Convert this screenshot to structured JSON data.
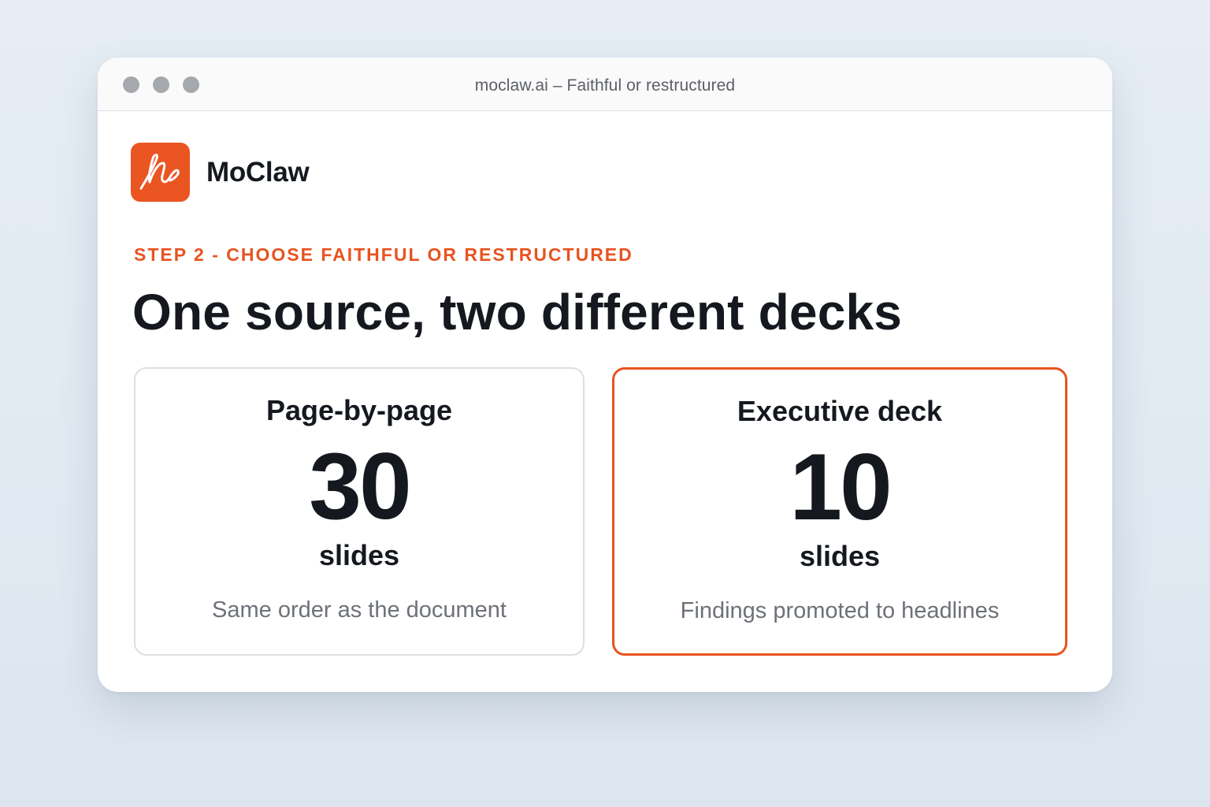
{
  "window": {
    "title": "moclaw.ai – Faithful or restructured"
  },
  "brand": {
    "name": "MoClaw",
    "accent_color": "#ea5522",
    "logo_icon": "scribble-signature-icon"
  },
  "step": {
    "label": "STEP 2 - CHOOSE FAITHFUL OR RESTRUCTURED"
  },
  "headline": "One source, two different decks",
  "options": [
    {
      "title": "Page-by-page",
      "count": "30",
      "unit": "slides",
      "description": "Same order as the document",
      "selected": false
    },
    {
      "title": "Executive deck",
      "count": "10",
      "unit": "slides",
      "description": "Findings promoted to headlines",
      "selected": true
    }
  ]
}
